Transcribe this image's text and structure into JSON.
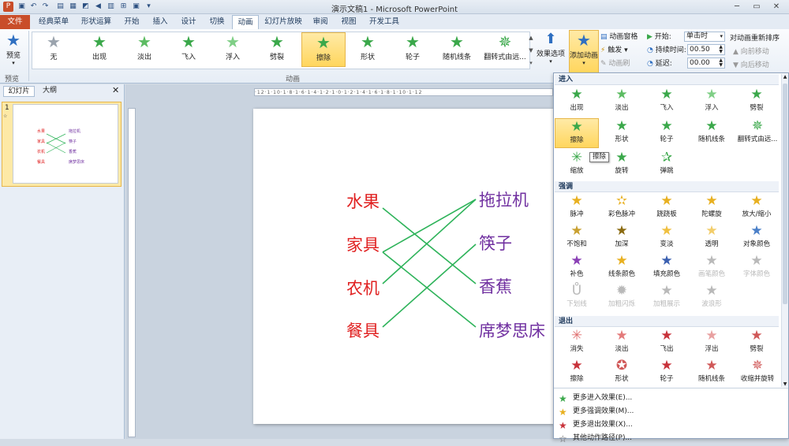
{
  "title_bar": {
    "title": "演示文稿1 - Microsoft PowerPoint"
  },
  "tabs": [
    "文件",
    "经典菜单",
    "形状运算",
    "开始",
    "插入",
    "设计",
    "切换",
    "动画",
    "幻灯片放映",
    "审阅",
    "视图",
    "开发工具"
  ],
  "ribbon": {
    "preview_label": "预览",
    "preview_group": "预览",
    "animation_group": "动画",
    "effects": [
      "无",
      "出现",
      "淡出",
      "飞入",
      "浮入",
      "劈裂",
      "擦除",
      "形状",
      "轮子",
      "随机线条",
      "翻转式由远..."
    ],
    "effect_options": "效果选项",
    "add_animation": "添加动画",
    "animation_pane": "动画窗格",
    "trigger": "触发",
    "painter": "动画刷",
    "start_label": "开始:",
    "start_value": "单击时",
    "duration_label": "持续时间:",
    "duration_value": "00.50",
    "delay_label": "延迟:",
    "delay_value": "00.00",
    "reorder_title": "对动画重新排序",
    "move_earlier": "向前移动",
    "move_later": "向后移动"
  },
  "left_panel": {
    "tab_slides": "幻灯片",
    "tab_outline": "大纲",
    "slide_number": "1"
  },
  "slide": {
    "left_items": [
      "水果",
      "家具",
      "农机",
      "餐具"
    ],
    "right_items": [
      "拖拉机",
      "筷子",
      "香蕉",
      "席梦思床"
    ]
  },
  "dropdown": {
    "entrance_title": "进入",
    "entrance": [
      "出现",
      "淡出",
      "飞入",
      "浮入",
      "劈裂",
      "擦除",
      "形状",
      "轮子",
      "随机线条",
      "翻转式由远...",
      "缩放",
      "旋转",
      "弹跳"
    ],
    "tooltip": "擦除",
    "emphasis_title": "强调",
    "emphasis": [
      "脉冲",
      "彩色脉冲",
      "跷跷板",
      "陀螺旋",
      "放大/缩小",
      "不饱和",
      "加深",
      "变淡",
      "透明",
      "对象颜色",
      "补色",
      "线条颜色",
      "填充颜色",
      "画笔颜色",
      "字体颜色",
      "下划线",
      "加粗闪烁",
      "加粗展示",
      "波浪形"
    ],
    "exit_title": "退出",
    "exit": [
      "消失",
      "淡出",
      "飞出",
      "浮出",
      "劈裂",
      "擦除",
      "形状",
      "轮子",
      "随机线条",
      "收缩并旋转"
    ],
    "more_entrance": "更多进入效果(E)...",
    "more_emphasis": "更多强调效果(M)...",
    "more_exit": "更多退出效果(X)...",
    "more_path": "其他动作路径(P)..."
  },
  "colors": {
    "left_text": "#e02020",
    "right_text": "#7030a0",
    "lines": "#2eb35a",
    "file_tab": "#c94d2a",
    "selected": "#ffd65e"
  }
}
